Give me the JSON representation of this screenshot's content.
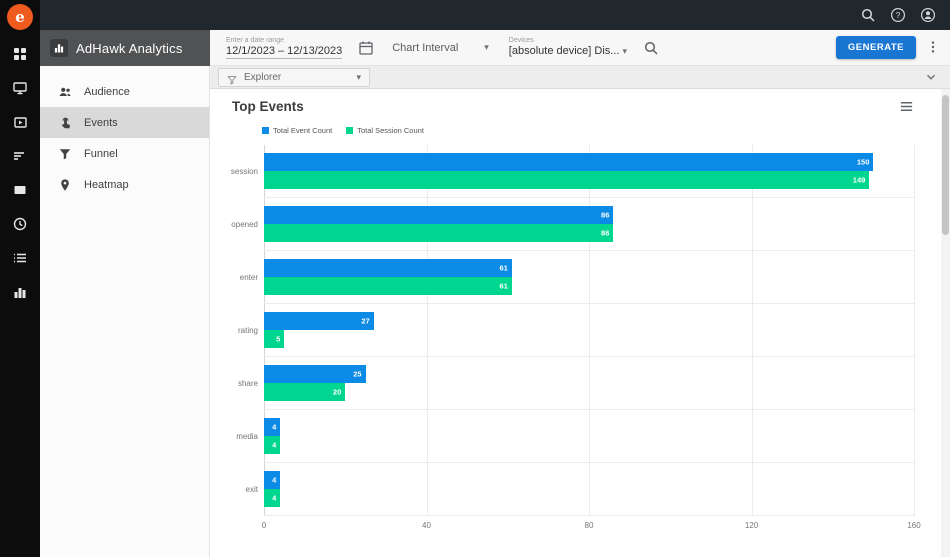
{
  "app": {
    "title": "AdHawk Analytics"
  },
  "topbar": {
    "icons": [
      "search",
      "help",
      "account"
    ]
  },
  "sidebar": {
    "items": [
      {
        "label": "Audience"
      },
      {
        "label": "Events"
      },
      {
        "label": "Funnel"
      },
      {
        "label": "Heatmap"
      }
    ]
  },
  "toolbar": {
    "date_label": "Enter a date range",
    "date_value": "12/1/2023 – 12/13/2023",
    "chart_interval_label": "Chart Interval",
    "devices_label": "Devices",
    "devices_value": "[absolute device] Dis...",
    "generate_label": "GENERATE"
  },
  "explorer": {
    "label": "Explorer"
  },
  "colors": {
    "accent_blue": "#1976d2",
    "bar_blue": "#0b8be6",
    "bar_green": "#00d68f"
  },
  "chart_data": {
    "type": "bar",
    "orientation": "horizontal",
    "title": "Top Events",
    "categories": [
      "session",
      "opened",
      "enter",
      "rating",
      "share",
      "media",
      "exit"
    ],
    "series": [
      {
        "name": "Total Event Count",
        "color": "#0b8be6",
        "values": [
          150,
          86,
          61,
          27,
          25,
          4,
          4
        ]
      },
      {
        "name": "Total Session Count",
        "color": "#00d68f",
        "values": [
          149,
          86,
          61,
          5,
          20,
          4,
          4
        ]
      }
    ],
    "xlim": [
      0,
      160
    ],
    "xticks": [
      0,
      40,
      80,
      120,
      160
    ],
    "grid": true,
    "legend_position": "top"
  }
}
